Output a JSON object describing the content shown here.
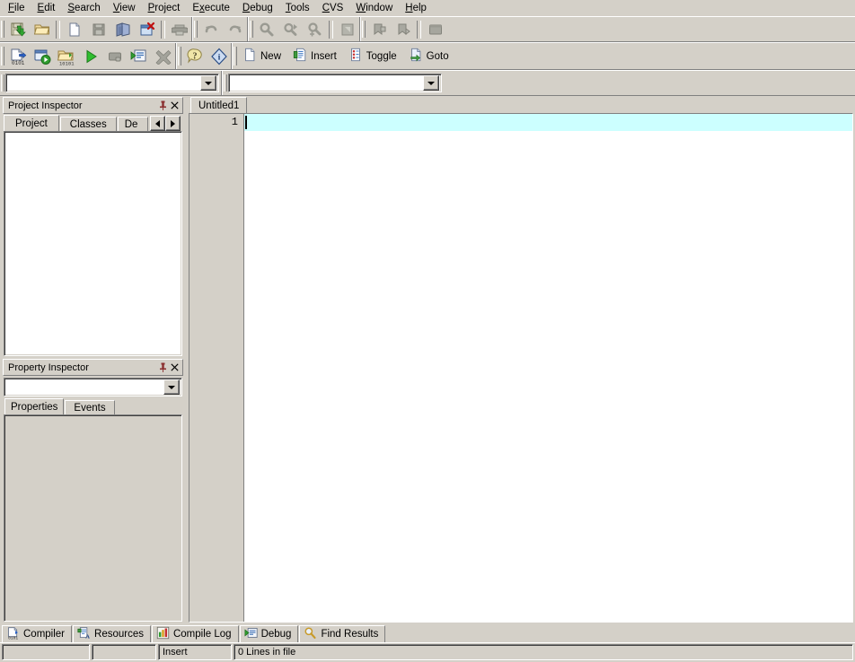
{
  "menubar": {
    "items": [
      {
        "label": "File",
        "accel": "F"
      },
      {
        "label": "Edit",
        "accel": "E"
      },
      {
        "label": "Search",
        "accel": "S"
      },
      {
        "label": "View",
        "accel": "V"
      },
      {
        "label": "Project",
        "accel": "P"
      },
      {
        "label": "Execute",
        "accel": "x"
      },
      {
        "label": "Debug",
        "accel": "D"
      },
      {
        "label": "Tools",
        "accel": "T"
      },
      {
        "label": "CVS",
        "accel": "C"
      },
      {
        "label": "Window",
        "accel": "W"
      },
      {
        "label": "Help",
        "accel": "H"
      }
    ]
  },
  "toolbar_row1": {
    "buttons": [
      {
        "icon": "save-icon",
        "enabled": true
      },
      {
        "icon": "open-folder-icon",
        "enabled": true
      },
      {
        "icon": "new-file-icon",
        "enabled": true
      },
      {
        "icon": "save-all-icon",
        "enabled": false
      },
      {
        "icon": "save-as-icon",
        "enabled": true
      },
      {
        "icon": "close-file-icon",
        "enabled": true
      },
      {
        "icon": "print-icon",
        "enabled": false
      },
      {
        "icon": "undo-icon",
        "enabled": false
      },
      {
        "icon": "redo-icon",
        "enabled": false
      },
      {
        "icon": "find-icon",
        "enabled": false
      },
      {
        "icon": "find-next-icon",
        "enabled": false
      },
      {
        "icon": "replace-icon",
        "enabled": false
      },
      {
        "icon": "goto-line-icon",
        "enabled": false
      },
      {
        "icon": "bookmark-add-icon",
        "enabled": false
      },
      {
        "icon": "bookmark-goto-icon",
        "enabled": false
      },
      {
        "icon": "window-icon",
        "enabled": false
      }
    ]
  },
  "toolbar_row2": {
    "buttons": [
      {
        "icon": "compile-icon",
        "enabled": true
      },
      {
        "icon": "run-icon",
        "enabled": true
      },
      {
        "icon": "compile-and-run-icon",
        "enabled": true
      },
      {
        "icon": "play-icon",
        "enabled": true
      },
      {
        "icon": "stop-execution-icon",
        "enabled": false
      },
      {
        "icon": "debug-icon",
        "enabled": true
      },
      {
        "icon": "abort-compilation-icon",
        "enabled": false
      },
      {
        "icon": "help-icon",
        "enabled": true
      },
      {
        "icon": "about-icon",
        "enabled": true
      }
    ],
    "labeled": [
      {
        "label": "New",
        "icon": "new-page-icon"
      },
      {
        "label": "Insert",
        "icon": "insert-snippet-icon"
      },
      {
        "label": "Toggle",
        "icon": "toggle-snippet-icon"
      },
      {
        "label": "Goto",
        "icon": "goto-function-icon"
      }
    ]
  },
  "toolbar_row3": {
    "class_combo": {
      "value": "",
      "placeholder": ""
    },
    "function_combo": {
      "value": "",
      "placeholder": ""
    }
  },
  "project_inspector": {
    "title": "Project Inspector",
    "pin_icon": "pushpin-icon",
    "close_icon": "close-icon",
    "tabs": [
      {
        "label": "Project",
        "selected": true
      },
      {
        "label": "Classes",
        "selected": false
      },
      {
        "label": "De",
        "selected": false
      }
    ],
    "scroll_left_icon": "arrow-left-icon",
    "scroll_right_icon": "arrow-right-icon",
    "tree_items": []
  },
  "property_inspector": {
    "title": "Property Inspector",
    "pin_icon": "pushpin-icon",
    "close_icon": "close-icon",
    "object_combo": {
      "value": ""
    },
    "tabs": [
      {
        "label": "Properties",
        "selected": true
      },
      {
        "label": "Events",
        "selected": false
      }
    ],
    "rows": []
  },
  "editor": {
    "tabs": [
      {
        "label": "Untitled1",
        "selected": true
      }
    ],
    "lines": [
      {
        "number": "1",
        "text": ""
      }
    ],
    "current_line_color": "#ccffff"
  },
  "bottom_panel": {
    "tabs": [
      {
        "label": "Compiler",
        "icon": "compiler-icon"
      },
      {
        "label": "Resources",
        "icon": "resources-icon"
      },
      {
        "label": "Compile Log",
        "icon": "compile-log-icon"
      },
      {
        "label": "Debug",
        "icon": "debug-icon"
      },
      {
        "label": "Find Results",
        "icon": "find-results-icon"
      }
    ]
  },
  "statusbar": {
    "panel1": "",
    "panel2": "",
    "insert_mode": "Insert",
    "line_count": "0 Lines in file"
  },
  "colors": {
    "face": "#d4d0c8",
    "shadow": "#808080",
    "highlight": "#ffffff",
    "dark": "#404040",
    "current_line": "#ccffff",
    "editor_bg": "#ffffff"
  }
}
